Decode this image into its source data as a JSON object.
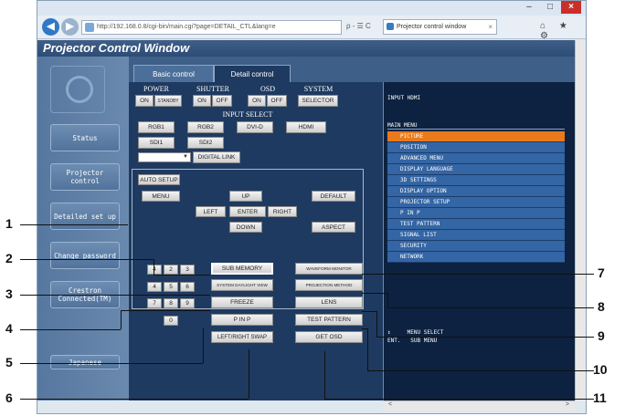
{
  "browser": {
    "url": "http://192.168.0.8/cgi-bin/main.cgi?page=DETAIL_CTL&lang=e",
    "url_tools": "ρ - ☰ C",
    "tab_title": "Projector control window",
    "tab_close": "×",
    "nav_icons": "⌂ ★ ⚙",
    "win_min": "–",
    "win_max": "□",
    "win_close": "×"
  },
  "app": {
    "title": "Projector Control Window",
    "tabs": {
      "basic": "Basic control",
      "detail": "Detail control"
    }
  },
  "sidebar": {
    "status": "Status",
    "projector_control": "Projector control",
    "detailed_setup": "Detailed set up",
    "change_password": "Change password",
    "crestron": "Crestron Connected(TM)",
    "japanese": "Japanese"
  },
  "control": {
    "labels": {
      "power": "POWER",
      "shutter": "SHUTTER",
      "osd": "OSD",
      "system": "SYSTEM",
      "input_select": "INPUT SELECT"
    },
    "power": {
      "on": "ON",
      "standby": "STANDBY"
    },
    "shutter": {
      "on": "ON",
      "off": "OFF"
    },
    "osd": {
      "on": "ON",
      "off": "OFF"
    },
    "system": {
      "selector": "SELECTOR"
    },
    "inputs": {
      "rgb1": "RGB1",
      "rgb2": "RGB2",
      "dvi_d": "DVI-D",
      "hdmi": "HDMI",
      "sdi1": "SDI1",
      "sdi2": "SDI2",
      "digital_link": "DIGITAL LINK"
    },
    "menu": {
      "auto_setup": "AUTO SETUP",
      "menu": "MENU",
      "up": "UP",
      "default": "DEFAULT",
      "left": "LEFT",
      "enter": "ENTER",
      "right": "RIGHT",
      "down": "DOWN",
      "aspect": "ASPECT"
    },
    "keypad": [
      "4",
      "2",
      "3",
      "4",
      "5",
      "6",
      "7",
      "8",
      "9",
      "0"
    ],
    "functions": {
      "sub_memory": "SUB MEMORY",
      "system_daylight_view": "SYSTEM DAYLIGHT VIEW",
      "freeze": "FREEZE",
      "pinp": "P IN P",
      "left_right_swap": "LEFT/RIGHT SWAP",
      "waveform_monitor": "WAVEFORM MONITOR",
      "projection_method": "PROJECTION METHOD",
      "lens": "LENS",
      "test_pattern": "TEST PATTERN",
      "get_osd": "GET OSD"
    }
  },
  "menu_panel": {
    "header": "INPUT HDMI",
    "title": "MAIN MENU",
    "items": [
      "PICTURE",
      "POSITION",
      "ADVANCED MENU",
      "DISPLAY LANGUAGE",
      "3D SETTINGS",
      "DISPLAY OPTION",
      "PROJECTOR SETUP",
      "P IN P",
      "TEST PATTERN",
      "SIGNAL LIST",
      "SECURITY",
      "NETWORK"
    ],
    "selected_index": 0,
    "help": "↕     MENU SELECT\nENT.   SUB MENU",
    "scroll_left": "<",
    "scroll_right": ">"
  },
  "callouts": [
    "1",
    "2",
    "3",
    "4",
    "5",
    "6",
    "7",
    "8",
    "9",
    "10",
    "11"
  ]
}
